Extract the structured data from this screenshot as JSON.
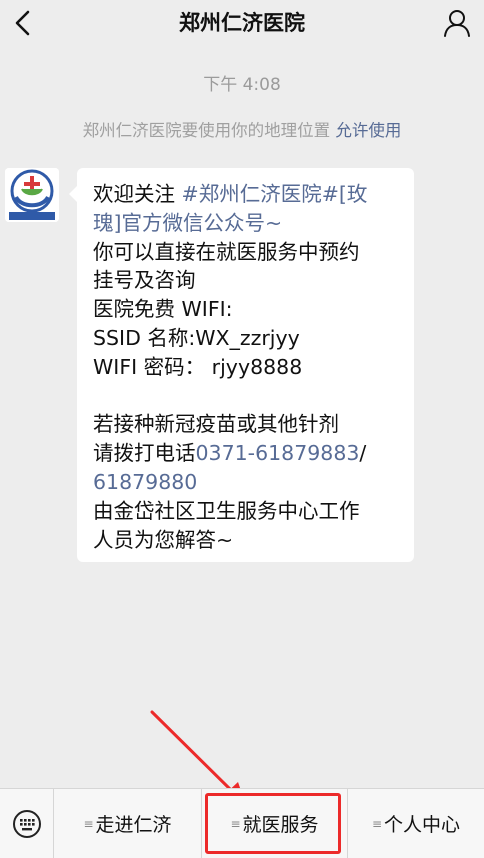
{
  "header": {
    "title": "郑州仁济医院",
    "back_icon": "chevron-left-icon",
    "profile_icon": "person-icon"
  },
  "timestamp": "下午 4:08",
  "system_tip": {
    "text": "郑州仁济医院要使用你的地理位置 ",
    "action": "允许使用",
    "action_color": "#576b95"
  },
  "message": {
    "line1_prefix": "欢迎关注 ",
    "line1_link": "#郑州仁济医院#[玫",
    "line2_link": "瑰]官方微信公众号~",
    "line3": "你可以直接在就医服务中预约",
    "line4": "挂号及咨询",
    "line5": "医院免费 WIFI:",
    "line6": "SSID 名称:WX_zzrjyy",
    "line7": "WIFI 密码： rjyy8888",
    "line9": "若接种新冠疫苗或其他针剂",
    "line10_prefix": "请拨打电话",
    "phone1": "0371-61879883",
    "slash": "/",
    "phone2": "61879880",
    "line12": "由金岱社区卫生服务中心工作",
    "line13": "人员为您解答~"
  },
  "bottom_menu": {
    "keyboard_icon": "keyboard-icon",
    "items": [
      {
        "label": "走进仁济"
      },
      {
        "label": "就医服务"
      },
      {
        "label": "个人中心"
      }
    ]
  },
  "colors": {
    "background": "#ededed",
    "link": "#576b95",
    "annotation": "#ec2a2a"
  }
}
